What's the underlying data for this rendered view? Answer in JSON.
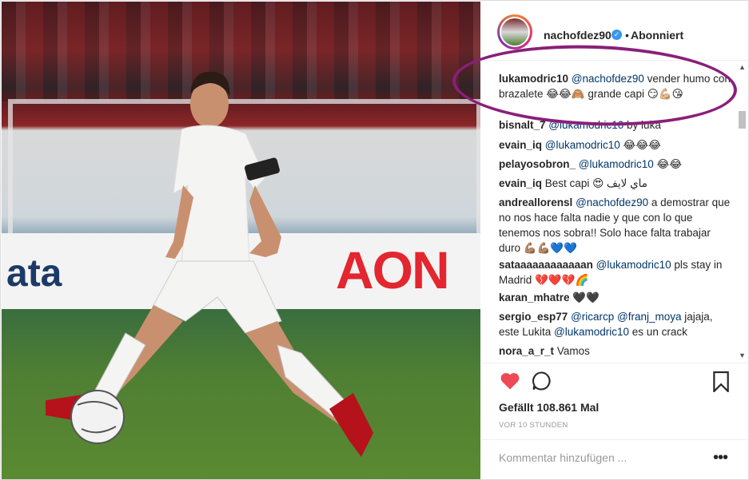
{
  "post": {
    "username": "nachofdez90",
    "verified_mark": "✓",
    "dot": "•",
    "follow_status": "Abonniert"
  },
  "photo": {
    "sponsor_text": "AON",
    "banner_text": "ata"
  },
  "comments": [
    {
      "user": "lukamodric10",
      "mention": "@nachofdez90",
      "text": " vender humo con brazalete 😂😂🙈 grande capi 😏💪🏼😘"
    },
    {
      "user": "bisnalt_7",
      "mention": "@lukamodric10",
      "text": " by luka"
    },
    {
      "user": "evain_iq",
      "mention": "@lukamodric10",
      "text": " 😂😂😂"
    },
    {
      "user": "pelayosobron_",
      "mention": "@lukamodric10",
      "text": " 😂😂"
    },
    {
      "user": "evain_iq",
      "mention": "",
      "text": " Best capi 😍 ماي لايف"
    },
    {
      "user": "andreallorensl",
      "mention": "@nachofdez90",
      "text": " a demostrar que no nos hace falta nadie y que con lo que tenemos nos sobra!! Solo hace falta trabajar duro 💪🏽💪🏽💙💙"
    },
    {
      "user": "sataaaaaaaaaaaan",
      "mention": "@lukamodric10",
      "text": " pls stay in Madrid 💔❤️💔🌈"
    },
    {
      "user": "karan_mhatre",
      "mention": "",
      "text": " 🖤🖤"
    },
    {
      "user": "sergio_esp77",
      "mention": "@ricarcp @franj_moya",
      "text": " jajaja, este Lukita ",
      "mention2": "@lukamodric10",
      "text2": " es un crack"
    },
    {
      "user": "nora_a_r_t",
      "mention": "",
      "text": " Vamos"
    }
  ],
  "actions": {
    "likes": "Gefällt 108.861 Mal",
    "time": "VOR 10 STUNDEN",
    "add_comment_placeholder": "Kommentar hinzufügen ...",
    "more": "•••"
  },
  "scrollbar": {
    "up": "▲",
    "down": "▼"
  },
  "colors": {
    "highlight_ellipse": "#8a1f7a",
    "heart": "#ed4956",
    "mention": "#003569"
  }
}
